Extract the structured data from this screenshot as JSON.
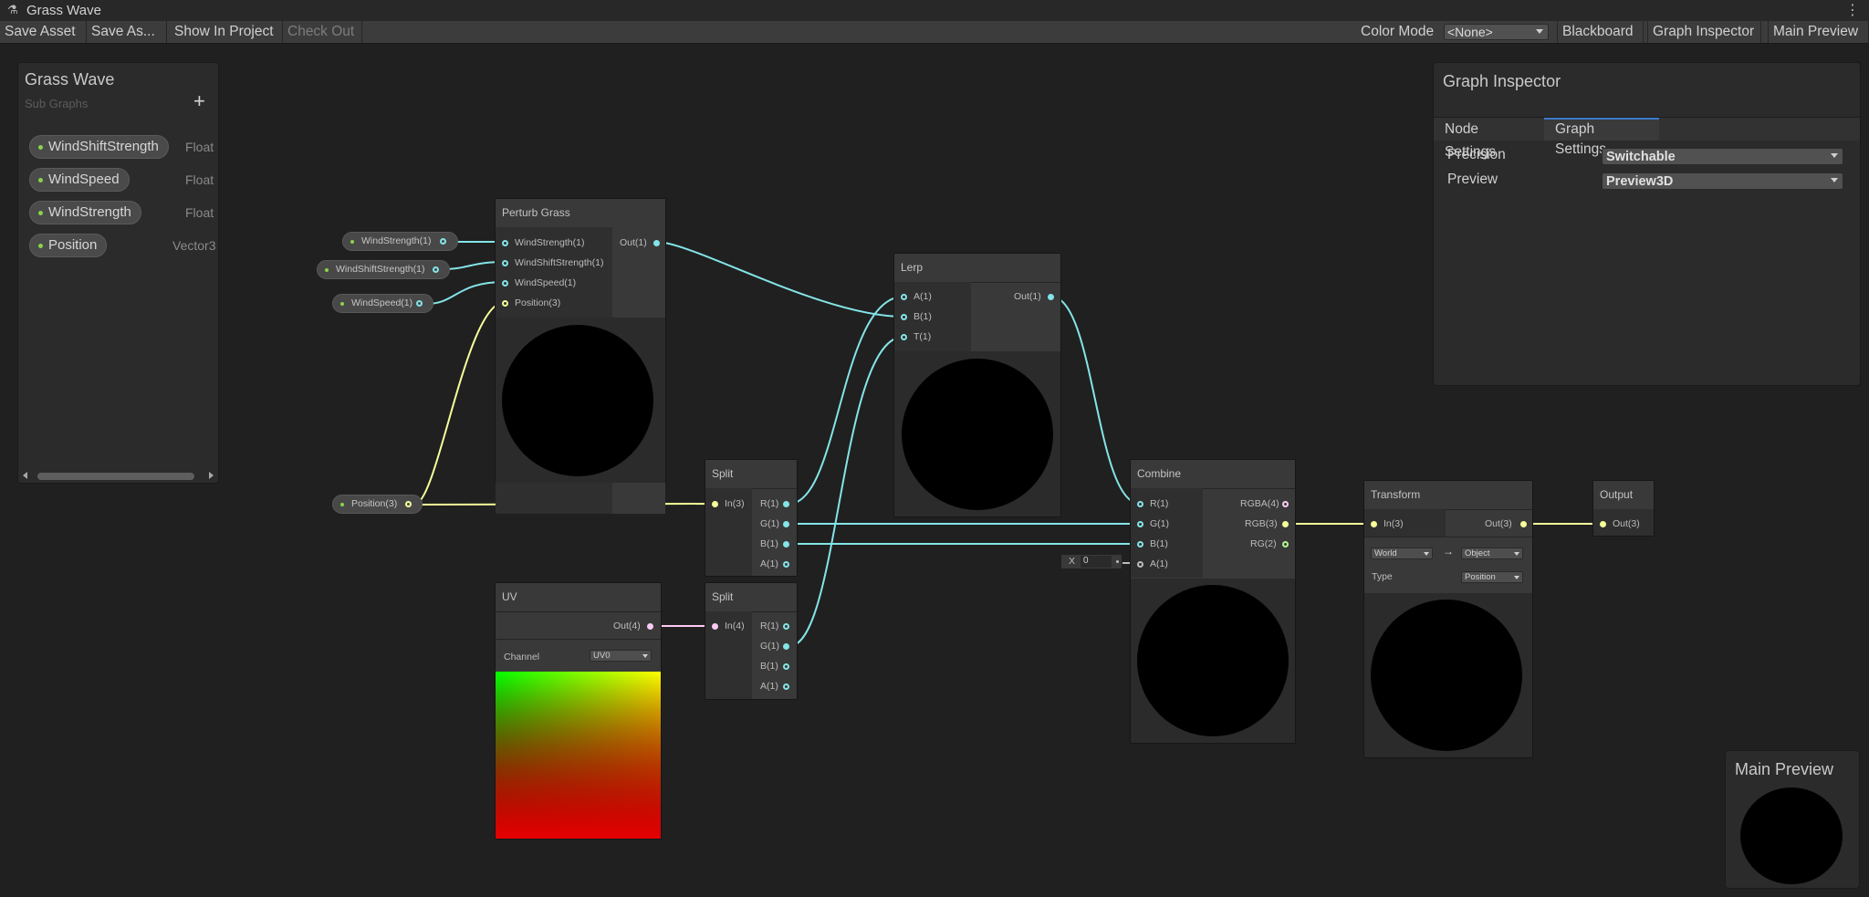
{
  "window": {
    "title": "Grass Wave"
  },
  "toolbar": {
    "save_asset": "Save Asset",
    "save_as": "Save As...",
    "show_in_project": "Show In Project",
    "check_out": "Check Out",
    "color_mode_label": "Color Mode",
    "color_mode_value": "<None>",
    "blackboard": "Blackboard",
    "graph_inspector": "Graph Inspector",
    "main_preview": "Main Preview"
  },
  "blackboard": {
    "title": "Grass Wave",
    "subtitle": "Sub Graphs",
    "properties": [
      {
        "name": "WindShiftStrength",
        "type": "Float"
      },
      {
        "name": "WindSpeed",
        "type": "Float"
      },
      {
        "name": "WindStrength",
        "type": "Float"
      },
      {
        "name": "Position",
        "type": "Vector3"
      }
    ]
  },
  "inspector": {
    "title": "Graph Inspector",
    "tabs": [
      "Node Settings",
      "Graph Settings"
    ],
    "active_tab": "Graph Settings",
    "rows": [
      {
        "label": "Precision",
        "value": "Switchable"
      },
      {
        "label": "Preview",
        "value": "Preview3D"
      }
    ]
  },
  "main_preview": {
    "title": "Main Preview"
  },
  "graph": {
    "property_nodes": {
      "wind_strength": "WindStrength(1)",
      "wind_shift_strength": "WindShiftStrength(1)",
      "wind_speed": "WindSpeed(1)",
      "position": "Position(3)"
    },
    "perturb": {
      "title": "Perturb Grass",
      "inputs": [
        "WindStrength(1)",
        "WindShiftStrength(1)",
        "WindSpeed(1)",
        "Position(3)"
      ],
      "output": "Out(1)"
    },
    "lerp": {
      "title": "Lerp",
      "inputs": [
        "A(1)",
        "B(1)",
        "T(1)"
      ],
      "output": "Out(1)"
    },
    "split1": {
      "title": "Split",
      "input": "In(3)",
      "outputs": [
        "R(1)",
        "G(1)",
        "B(1)",
        "A(1)"
      ]
    },
    "split2": {
      "title": "Split",
      "input": "In(4)",
      "outputs": [
        "R(1)",
        "G(1)",
        "B(1)",
        "A(1)"
      ]
    },
    "uv": {
      "title": "UV",
      "output": "Out(4)",
      "channel_label": "Channel",
      "channel_value": "UV0"
    },
    "combine": {
      "title": "Combine",
      "inputs": [
        "R(1)",
        "G(1)",
        "B(1)",
        "A(1)"
      ],
      "outputs": [
        "RGBA(4)",
        "RGB(3)",
        "RG(2)"
      ],
      "a_default_label": "X",
      "a_default_value": "0"
    },
    "transform": {
      "title": "Transform",
      "input": "In(3)",
      "output": "Out(3)",
      "from": "World",
      "to": "Object",
      "type_label": "Type",
      "type_value": "Position"
    },
    "output": {
      "title": "Output",
      "input": "Out(3)"
    }
  },
  "colors": {
    "float_port": "#84e4e7",
    "vector3_port": "#f6ff9a",
    "vector4_port": "#fbcbf4",
    "property_dot": "#8bd34a",
    "tab_accent": "#3a7acb"
  }
}
